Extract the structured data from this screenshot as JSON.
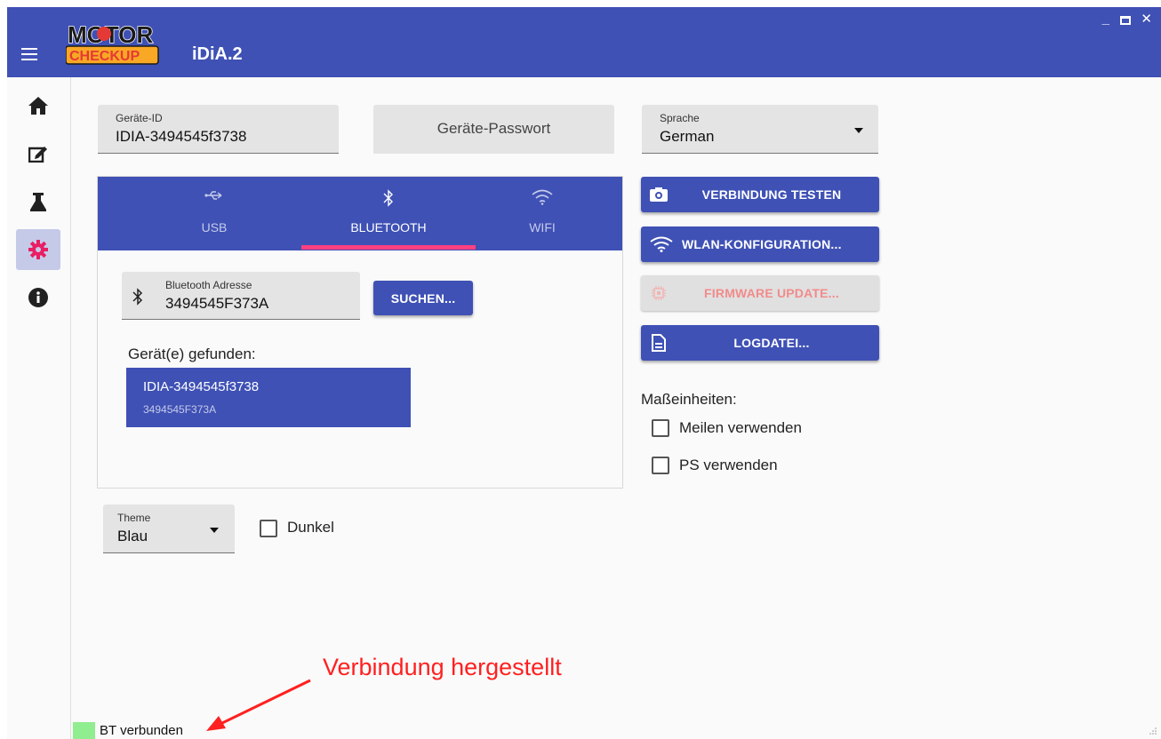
{
  "window": {
    "app_title": "iDiA.2",
    "logo_text_top": "MOTOR",
    "logo_text_bottom": "CHECKUP"
  },
  "sidebar": {
    "items": [
      {
        "icon": "home-icon"
      },
      {
        "icon": "edit-icon"
      },
      {
        "icon": "flask-icon"
      },
      {
        "icon": "gear-icon",
        "active": true
      },
      {
        "icon": "info-icon"
      }
    ]
  },
  "settings": {
    "device_id": {
      "label": "Geräte-ID",
      "value": "IDIA-3494545f3738"
    },
    "device_password": {
      "placeholder": "Geräte-Passwort"
    },
    "language": {
      "label": "Sprache",
      "value": "German"
    },
    "tabs": [
      {
        "label": "USB",
        "icon": "usb-icon"
      },
      {
        "label": "BLUETOOTH",
        "icon": "bluetooth-icon",
        "active": true
      },
      {
        "label": "WIFI",
        "icon": "wifi-icon"
      }
    ],
    "bluetooth": {
      "address_label": "Bluetooth Adresse",
      "address_value": "3494545F373A",
      "search_button": "SUCHEN...",
      "found_label": "Gerät(e) gefunden:",
      "found_devices": [
        {
          "name": "IDIA-3494545f3738",
          "address": "3494545F373A"
        }
      ]
    },
    "actions": {
      "test_connection": "VERBINDUNG TESTEN",
      "wlan_config": "WLAN-KONFIGURATION...",
      "firmware_update": "FIRMWARE UPDATE...",
      "logfile": "LOGDATEI..."
    },
    "units": {
      "label": "Maßeinheiten:",
      "miles": {
        "label": "Meilen verwenden",
        "checked": false
      },
      "hp": {
        "label": "PS verwenden",
        "checked": false
      }
    },
    "theme": {
      "label": "Theme",
      "value": "Blau"
    },
    "dark": {
      "label": "Dunkel",
      "checked": false
    }
  },
  "annotation": "Verbindung hergestellt",
  "status": {
    "text": "BT verbunden",
    "color": "#90ee90"
  },
  "colors": {
    "primary": "#3f51b5",
    "accent": "#ff4081",
    "annotation": "#ff2020"
  }
}
